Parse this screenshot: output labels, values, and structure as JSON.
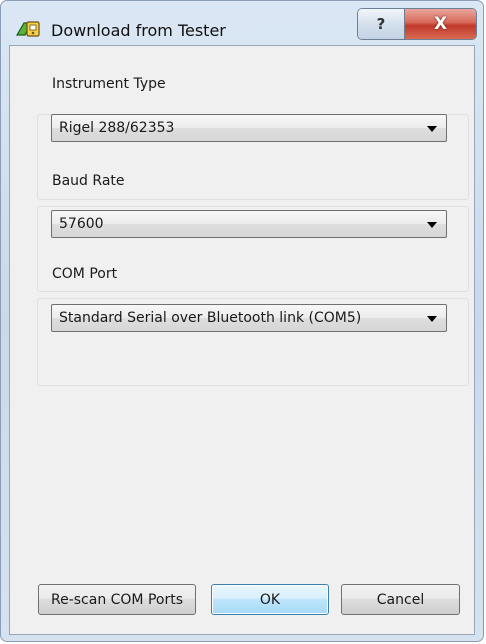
{
  "window": {
    "title": "Download from Tester",
    "icon": "tester-app-icon",
    "help_glyph": "?",
    "close_glyph": "X"
  },
  "groups": {
    "instrument_type": {
      "label": "Instrument Type",
      "value": "Rigel 288/62353"
    },
    "baud_rate": {
      "label": "Baud Rate",
      "value": "57600"
    },
    "com_port": {
      "label": "COM Port",
      "value": "Standard Serial over Bluetooth link (COM5)"
    }
  },
  "buttons": {
    "rescan": "Re-scan COM Ports",
    "ok": "OK",
    "cancel": "Cancel"
  },
  "colors": {
    "frame": "#c9d9ea",
    "client": "#f0f0f0",
    "close_button": "#c1382a",
    "default_button_border": "#3c7fb1"
  }
}
